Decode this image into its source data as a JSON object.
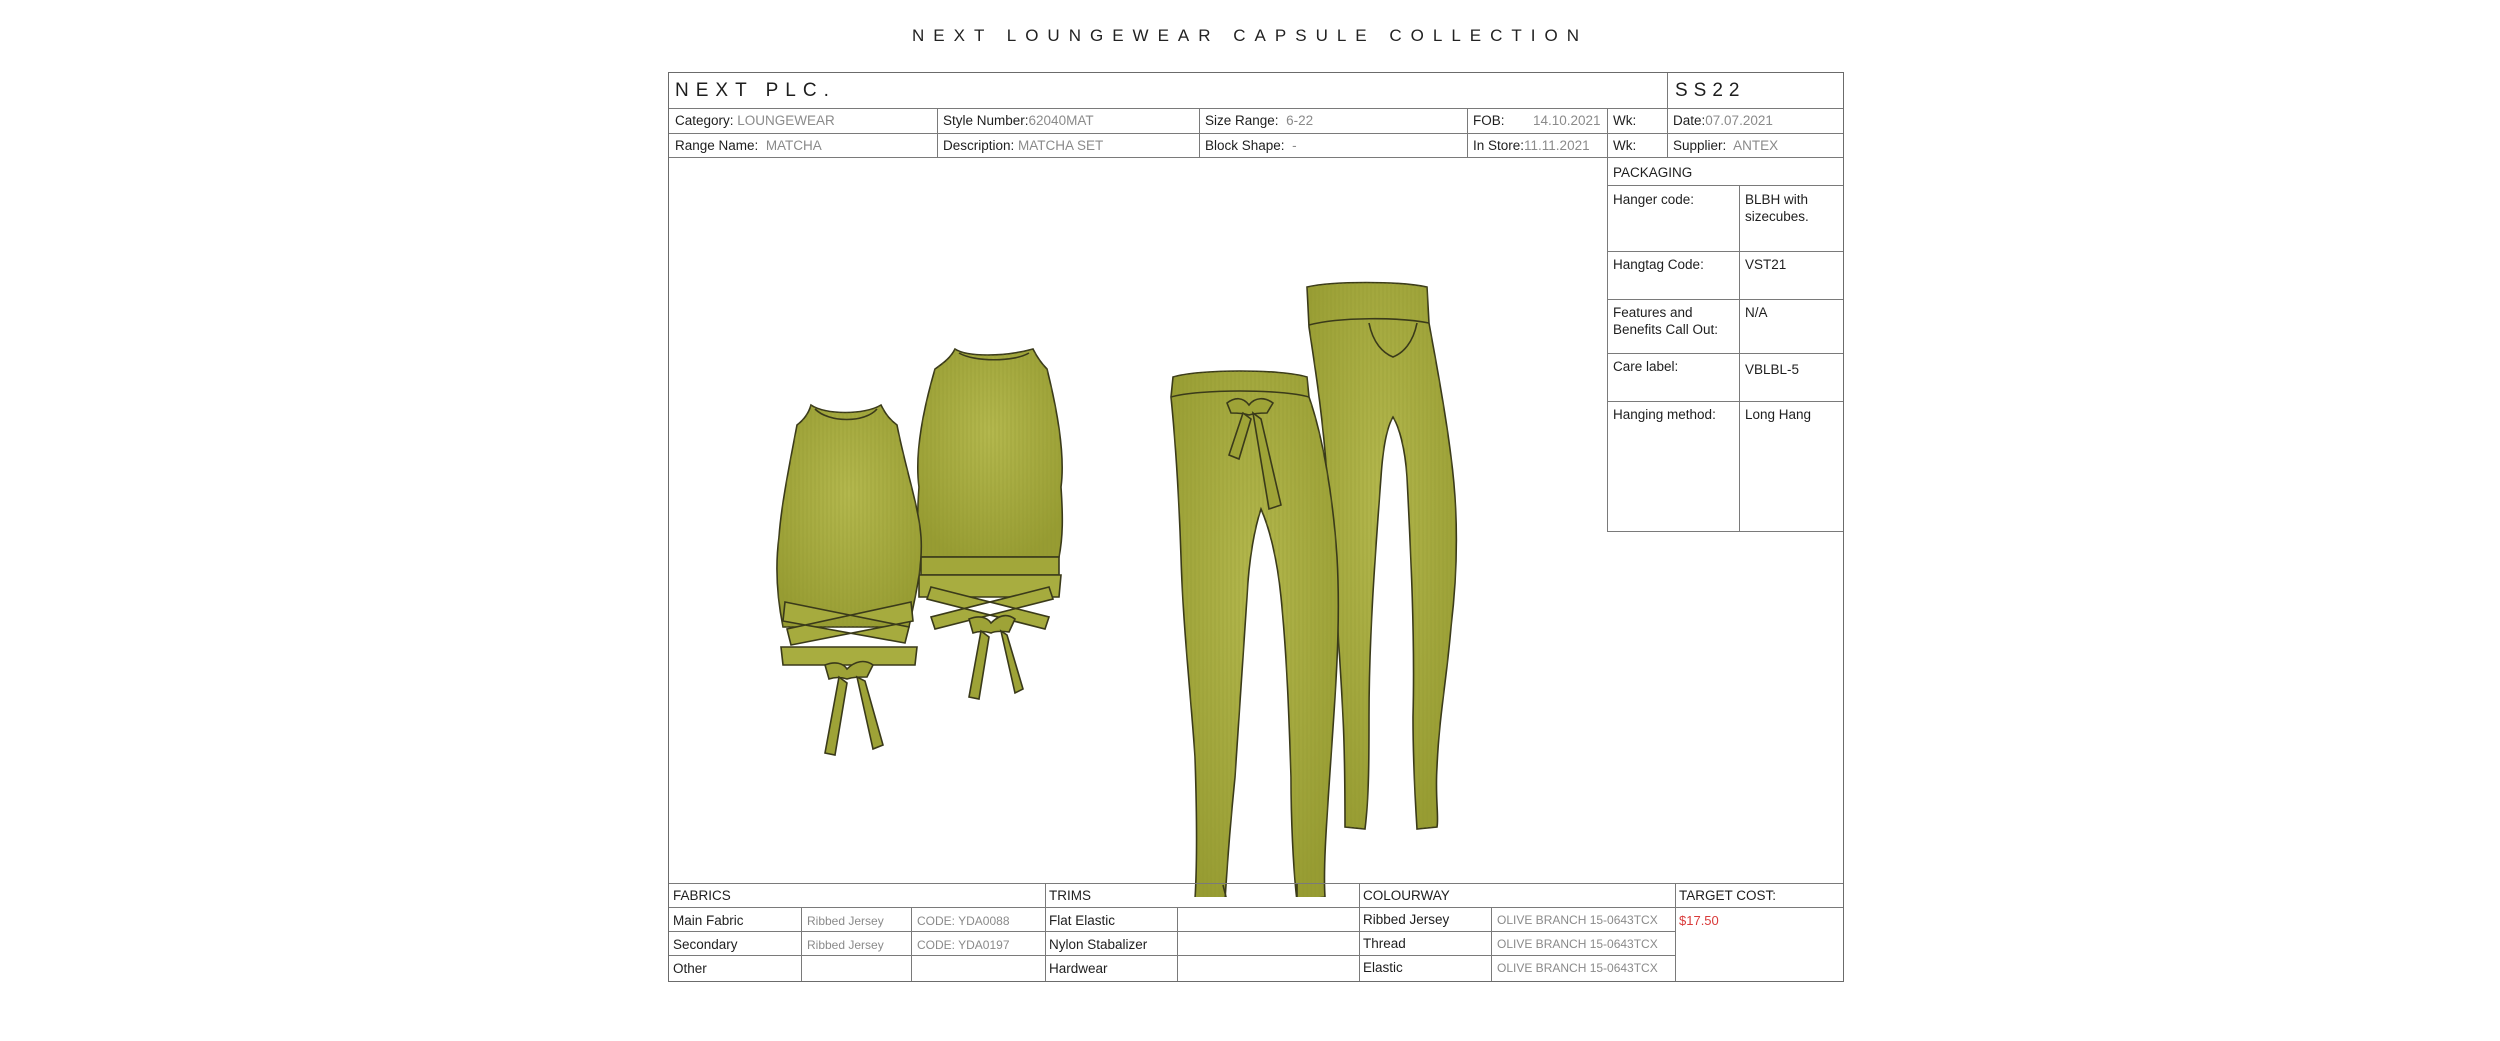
{
  "title": "NEXT LOUNGEWEAR CAPSULE COLLECTION",
  "header": {
    "brand": "NEXT PLC.",
    "season": "SS22",
    "category_label": "Category:",
    "category_value": "LOUNGEWEAR",
    "style_label": "Style Number:",
    "style_value": "62040MAT",
    "size_label": "Size Range:",
    "size_value": "6-22",
    "fob_label": "FOB:",
    "fob_value": "14.10.2021",
    "wk1_label": "Wk:",
    "date_label": "Date:",
    "date_value": "07.07.2021",
    "range_label": "Range Name:",
    "range_value": "MATCHA",
    "desc_label": "Description:",
    "desc_value": "MATCHA SET",
    "block_label": "Block Shape:",
    "block_value": "-",
    "instore_label": "In Store:",
    "instore_value": "11.11.2021",
    "wk2_label": "Wk:",
    "supplier_label": "Supplier:",
    "supplier_value": "ANTEX"
  },
  "packaging": {
    "heading": "PACKAGING",
    "rows": [
      {
        "label": "Hanger code:",
        "value": "BLBH with sizecubes."
      },
      {
        "label": "Hangtag Code:",
        "value": "VST21"
      },
      {
        "label": "Features and Benefits Call Out:",
        "value": "N/A"
      },
      {
        "label": "Care label:",
        "value": "VBLBL-5"
      },
      {
        "label": "Hanging method:",
        "value": "Long Hang"
      }
    ]
  },
  "fabrics": {
    "heading": "FABRICS",
    "rows": [
      {
        "name": "Main Fabric",
        "type": "Ribbed Jersey",
        "code": "CODE: YDA0088"
      },
      {
        "name": "Secondary",
        "type": "Ribbed Jersey",
        "code": "CODE: YDA0197"
      },
      {
        "name": "Other",
        "type": "",
        "code": ""
      }
    ]
  },
  "trims": {
    "heading": "TRIMS",
    "rows": [
      "Flat Elastic",
      "Nylon Stabalizer",
      "Hardwear"
    ]
  },
  "colourway": {
    "heading": "COLOURWAY",
    "rows": [
      {
        "item": "Ribbed Jersey",
        "colour": "OLIVE BRANCH 15-0643TCX"
      },
      {
        "item": "Thread",
        "colour": "OLIVE BRANCH 15-0643TCX"
      },
      {
        "item": "Elastic",
        "colour": "OLIVE BRANCH 15-0643TCX"
      }
    ]
  },
  "target_cost": {
    "heading": "TARGET COST:",
    "value": "$17.50"
  },
  "colors": {
    "garment": "#a3a83c",
    "garment_shade": "#8e9330",
    "garment_light": "#b8bd55",
    "outline": "#3a3a1a",
    "price": "#d93a3a"
  }
}
